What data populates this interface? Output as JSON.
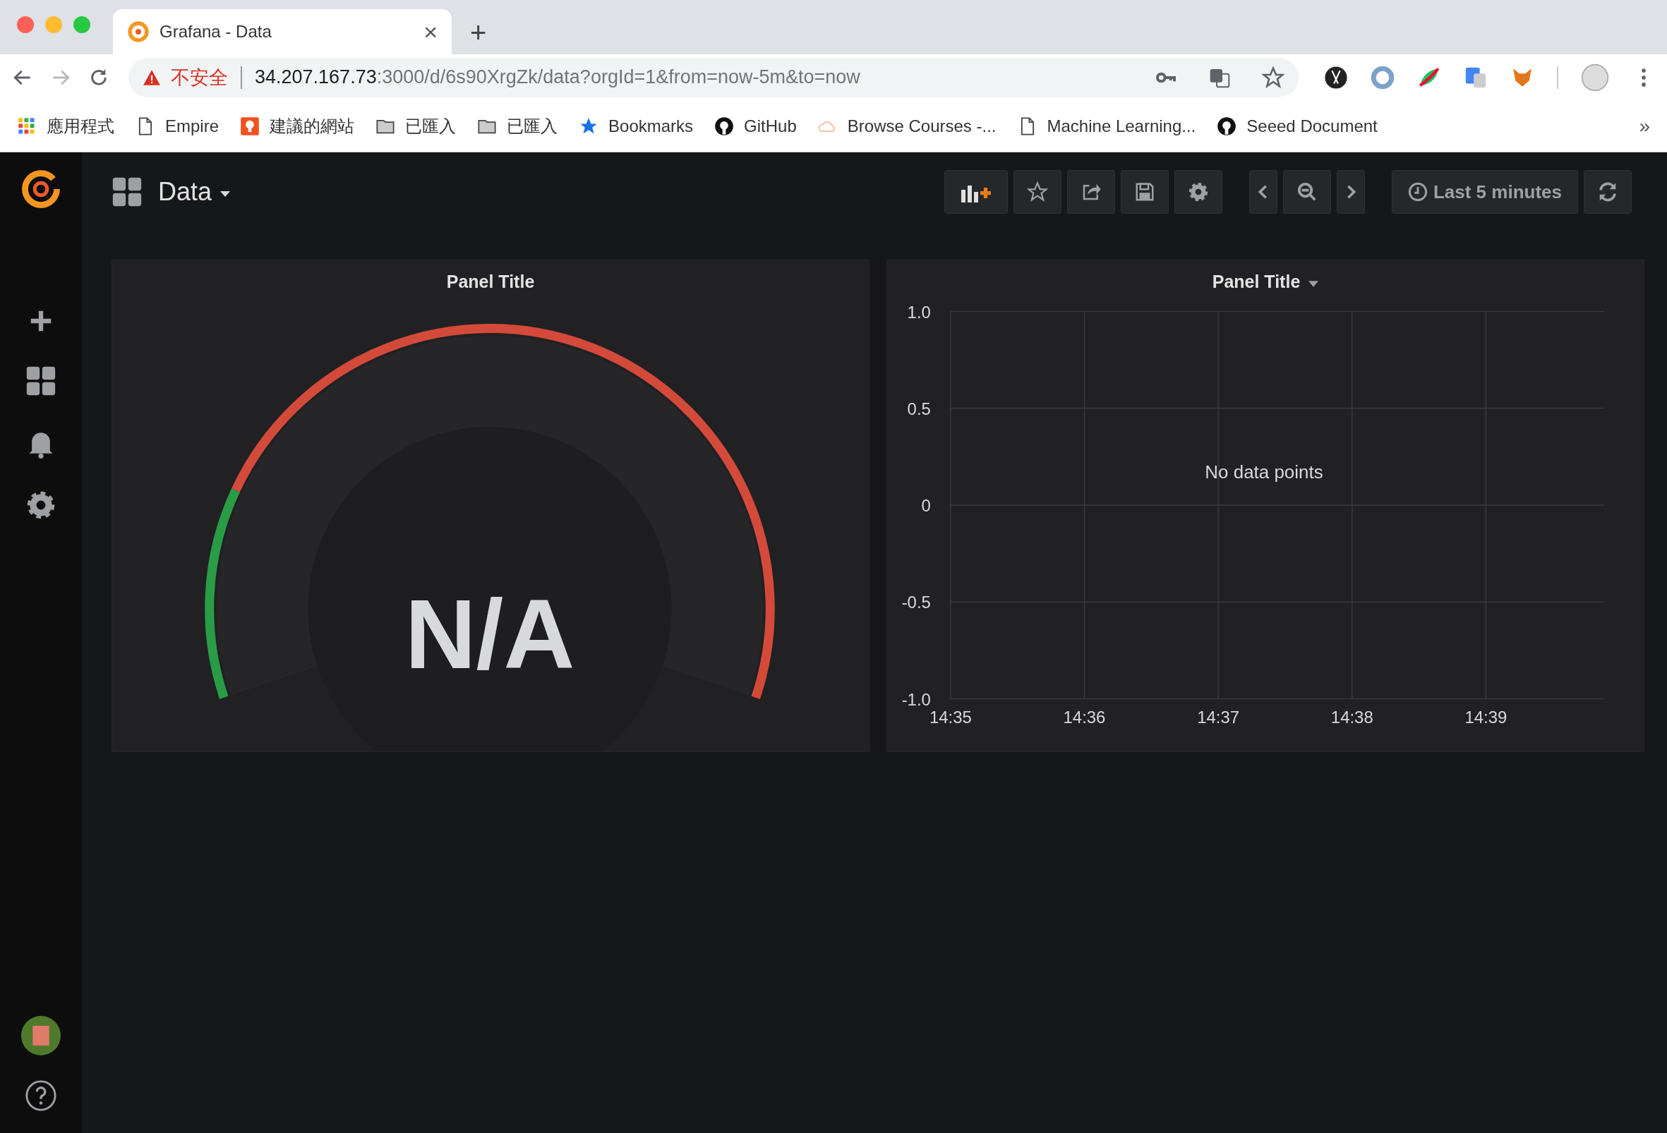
{
  "browser": {
    "tab": {
      "title": "Grafana - Data",
      "close": "×"
    },
    "new_tab": "+",
    "security": "不安全",
    "url_host": "34.207.167.73",
    "url_path": ":3000/d/6s90XrgZk/data?orgId=1&from=now-5m&to=now",
    "bookmarks": [
      {
        "label": "應用程式",
        "kind": "apps"
      },
      {
        "label": "Empire",
        "kind": "page"
      },
      {
        "label": "建議的網站",
        "kind": "bulb"
      },
      {
        "label": "已匯入",
        "kind": "folder"
      },
      {
        "label": "已匯入",
        "kind": "folder"
      },
      {
        "label": "Bookmarks",
        "kind": "star"
      },
      {
        "label": "GitHub",
        "kind": "github"
      },
      {
        "label": "Browse Courses -...",
        "kind": "cloud"
      },
      {
        "label": "Machine Learning...",
        "kind": "page"
      },
      {
        "label": "Seeed Document",
        "kind": "github"
      }
    ],
    "overflow": "»"
  },
  "dashboard": {
    "title": "Data",
    "time_range": "Last 5 minutes"
  },
  "panels": [
    {
      "kind": "gauge",
      "title": "Panel Title",
      "has_menu": false,
      "value": "N/A",
      "thresholds": [
        {
          "color": "#299c46"
        },
        {
          "color": "#d44a3a"
        }
      ]
    },
    {
      "kind": "graph",
      "title": "Panel Title",
      "has_menu": true,
      "message": "No data points",
      "yticks": [
        "1.0",
        "0.5",
        "0",
        "-0.5",
        "-1.0"
      ],
      "xticks": [
        "14:35",
        "14:36",
        "14:37",
        "14:38",
        "14:39"
      ]
    }
  ]
}
